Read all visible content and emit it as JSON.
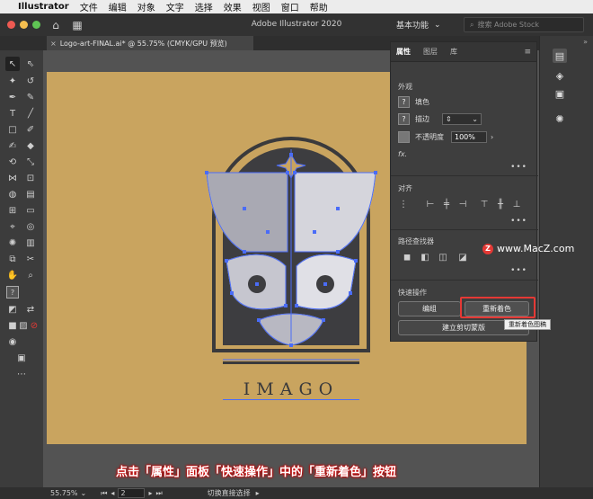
{
  "menubar": {
    "app_name": "Illustrator",
    "items": [
      "文件",
      "编辑",
      "对象",
      "文字",
      "选择",
      "效果",
      "视图",
      "窗口",
      "帮助"
    ]
  },
  "appbar": {
    "title": "Adobe Illustrator 2020",
    "workspace_label": "基本功能",
    "search_placeholder": "搜索 Adobe Stock"
  },
  "document": {
    "tab_label": "Logo-art-FINAL.ai* @ 55.75% (CMYK/GPU 预览)"
  },
  "artwork": {
    "logo_text": "IMAGO"
  },
  "properties_panel": {
    "tabs": [
      "属性",
      "图层",
      "库"
    ],
    "appearance": {
      "title": "外观",
      "fill_label": "填色",
      "stroke_label": "描边",
      "opacity_label": "不透明度",
      "opacity_value": "100%",
      "fx_label": "fx."
    },
    "align": {
      "title": "对齐"
    },
    "pathfinder": {
      "title": "路径查找器"
    },
    "quick_actions": {
      "title": "快速操作",
      "group_button": "编组",
      "recolor_button": "重新着色",
      "clipping_mask_button": "建立剪切蒙版",
      "tooltip": "重新着色图稿"
    }
  },
  "statusbar": {
    "zoom": "55.75%",
    "page": "2",
    "tool_hint": "切换直接选择"
  },
  "caption": "点击「属性」面板「快速操作」中的「重新着色」按钮",
  "watermark": "www.MacZ.com",
  "colors": {
    "artboard": "#c9a45f",
    "highlight": "#e53935",
    "selection": "#4a6cf7"
  }
}
